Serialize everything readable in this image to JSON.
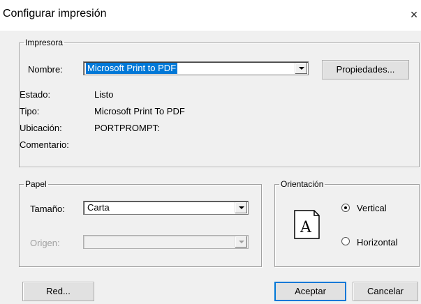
{
  "window": {
    "title": "Configurar impresión",
    "close_glyph": "×"
  },
  "printer_group": {
    "legend": "Impresora",
    "name_label": "Nombre:",
    "name_value": "Microsoft Print to PDF",
    "properties_button": "Propiedades...",
    "status_label": "Estado:",
    "status_value": "Listo",
    "type_label": "Tipo:",
    "type_value": "Microsoft Print To PDF",
    "location_label": "Ubicación:",
    "location_value": "PORTPROMPT:",
    "comment_label": "Comentario:"
  },
  "paper_group": {
    "legend": "Papel",
    "size_label": "Tamaño:",
    "size_value": "Carta",
    "source_label": "Origen:",
    "source_value": ""
  },
  "orientation_group": {
    "legend": "Orientación",
    "icon_letter": "A",
    "options": [
      {
        "label": "Vertical",
        "checked": true
      },
      {
        "label": "Horizontal",
        "checked": false
      }
    ]
  },
  "buttons": {
    "network": "Red...",
    "accept": "Aceptar",
    "cancel": "Cancelar"
  },
  "colors": {
    "selection": "#0078d7",
    "dialog_bg": "#f0f0f0"
  }
}
